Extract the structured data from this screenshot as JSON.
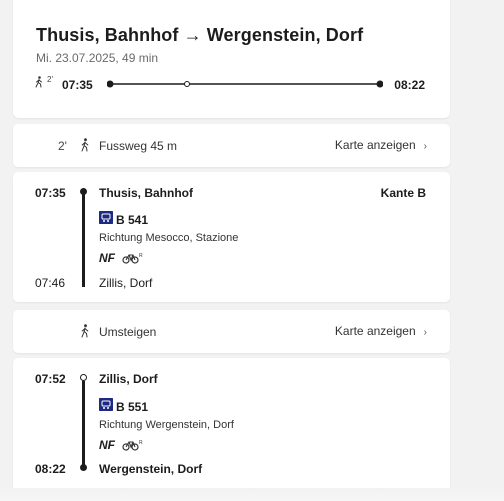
{
  "summary": {
    "title": "Thusis, Bahnhof → Wergenstein, Dorf",
    "subtitle": "Mi. 23.07.2025, 49 min",
    "walk_minutes": "2'",
    "departure": "07:35",
    "arrival": "08:22"
  },
  "walk": {
    "minutes": "2'",
    "label": "Fussweg 45 m",
    "map_link": "Karte anzeigen"
  },
  "leg1": {
    "dep_time": "07:35",
    "dep_stop": "Thusis, Bahnhof",
    "platform": "Kante B",
    "line": "B 541",
    "direction": "Richtung Mesocco, Stazione",
    "attribute": "NF",
    "arr_time": "07:46",
    "arr_stop": "Zillis, Dorf"
  },
  "transfer": {
    "label": "Umsteigen",
    "map_link": "Karte anzeigen"
  },
  "leg2": {
    "dep_time": "07:52",
    "dep_stop": "Zillis, Dorf",
    "line": "B 551",
    "direction": "Richtung Wergenstein, Dorf",
    "attribute": "NF",
    "arr_time": "08:22",
    "arr_stop": "Wergenstein, Dorf"
  },
  "icons": {
    "walk": "pedestrian-icon",
    "bus": "bus-icon",
    "bike": "bicycle-reservation-icon",
    "chevron": "chevron-right-icon"
  },
  "colors": {
    "bus_badge": "#1e2a82",
    "text": "#1c1c1c",
    "background": "#f2f2f2"
  }
}
